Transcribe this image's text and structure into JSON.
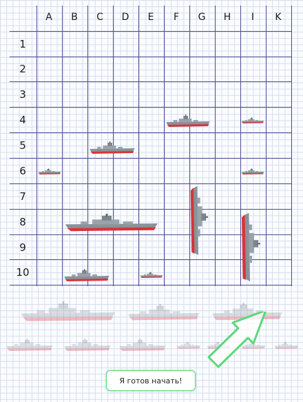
{
  "board": {
    "columns": [
      "A",
      "B",
      "C",
      "D",
      "E",
      "F",
      "G",
      "H",
      "I",
      "K"
    ],
    "rows": [
      "1",
      "2",
      "3",
      "4",
      "5",
      "6",
      "7",
      "8",
      "9",
      "10"
    ]
  },
  "placed_ships": [
    {
      "name": "ship-size-4",
      "cells": "B8–E8",
      "orientation": "horizontal"
    },
    {
      "name": "ship-size-3",
      "cells": "G7–G9",
      "orientation": "vertical"
    },
    {
      "name": "ship-size-3",
      "cells": "I8–I10",
      "orientation": "vertical"
    },
    {
      "name": "ship-size-2",
      "cells": "F4–G4",
      "orientation": "horizontal"
    },
    {
      "name": "ship-size-2",
      "cells": "C5–D5",
      "orientation": "horizontal"
    },
    {
      "name": "ship-size-2",
      "cells": "B10–C10",
      "orientation": "horizontal"
    },
    {
      "name": "ship-size-1",
      "cells": "I4",
      "orientation": "horizontal"
    },
    {
      "name": "ship-size-1",
      "cells": "A6",
      "orientation": "horizontal"
    },
    {
      "name": "ship-size-1",
      "cells": "I6",
      "orientation": "horizontal"
    },
    {
      "name": "ship-size-1",
      "cells": "E10",
      "orientation": "horizontal"
    }
  ],
  "ready_button": {
    "label": "Я готов начать!"
  },
  "colors": {
    "grid": "#4c4f96",
    "button_border": "#59d879",
    "arrow": "#59d879",
    "hull_red": "#d8343b",
    "hull_grey": "#8a929a"
  },
  "icons": {
    "arrow": "green-outline-arrow"
  }
}
